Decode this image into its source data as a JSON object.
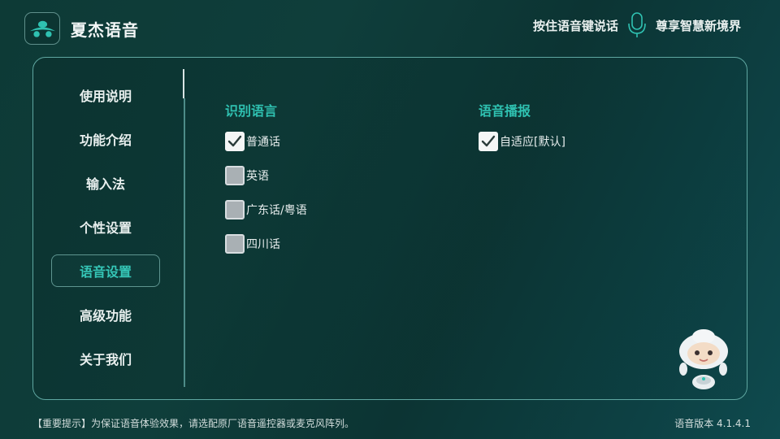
{
  "header": {
    "app_title": "夏杰语音",
    "hint": "按住语音键说话",
    "slogan": "尊享智慧新境界",
    "logo_icon": "app-logo-icon",
    "mic_icon": "microphone-icon"
  },
  "sidebar": {
    "items": [
      {
        "label": "使用说明",
        "active": false
      },
      {
        "label": "功能介绍",
        "active": false
      },
      {
        "label": "输入法",
        "active": false
      },
      {
        "label": "个性设置",
        "active": false
      },
      {
        "label": "语音设置",
        "active": true
      },
      {
        "label": "高级功能",
        "active": false
      },
      {
        "label": "关于我们",
        "active": false
      }
    ]
  },
  "recognition": {
    "title": "识别语言",
    "options": [
      {
        "label": "普通话",
        "checked": true
      },
      {
        "label": "英语",
        "checked": false
      },
      {
        "label": "广东话/粤语",
        "checked": false
      },
      {
        "label": "四川话",
        "checked": false
      }
    ]
  },
  "broadcast": {
    "title": "语音播报",
    "options": [
      {
        "label": "自适应[默认]",
        "checked": true
      }
    ]
  },
  "footer": {
    "note": "【重要提示】为保证语音体验效果，请选配原厂语音遥控器或麦克风阵列。",
    "version": "语音版本  4.1.4.1"
  },
  "colors": {
    "accent": "#2fc1b1",
    "background": "#0d3a36",
    "panel_border": "#5fa7a1"
  }
}
